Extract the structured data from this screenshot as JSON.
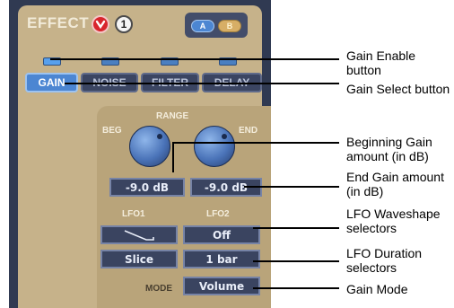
{
  "header": {
    "title": "EFFECT",
    "badge_number": "1",
    "button_a": "A",
    "button_b": "B"
  },
  "tabs": [
    {
      "label": "GAIN",
      "active": true
    },
    {
      "label": "NOISE",
      "active": false
    },
    {
      "label": "FILTER",
      "active": false
    },
    {
      "label": "DELAY",
      "active": false
    }
  ],
  "range": {
    "label": "RANGE",
    "beg_label": "BEG",
    "end_label": "END",
    "beg_value": "-9.0 dB",
    "end_value": "-9.0 dB"
  },
  "lfo": {
    "lfo1_label": "LFO1",
    "lfo2_label": "LFO2",
    "lfo2_waveshape": "Off",
    "lfo1_duration": "Slice",
    "lfo2_duration": "1 bar"
  },
  "mode": {
    "label": "MODE",
    "value": "Volume"
  },
  "callouts": {
    "gain_enable": "Gain Enable button",
    "gain_select": "Gain Select button",
    "beg_gain": "Beginning Gain amount (in dB)",
    "end_gain": "End Gain amount (in dB)",
    "lfo_waveshape": "LFO Waveshape selectors",
    "lfo_duration": "LFO Duration selectors",
    "gain_mode": "Gain Mode"
  },
  "colors": {
    "panel_bg": "#c6b28a",
    "frame": "#303a52",
    "accent_blue": "#4c86d2",
    "field_bg": "#3a4460",
    "power_red": "#d8252d"
  }
}
